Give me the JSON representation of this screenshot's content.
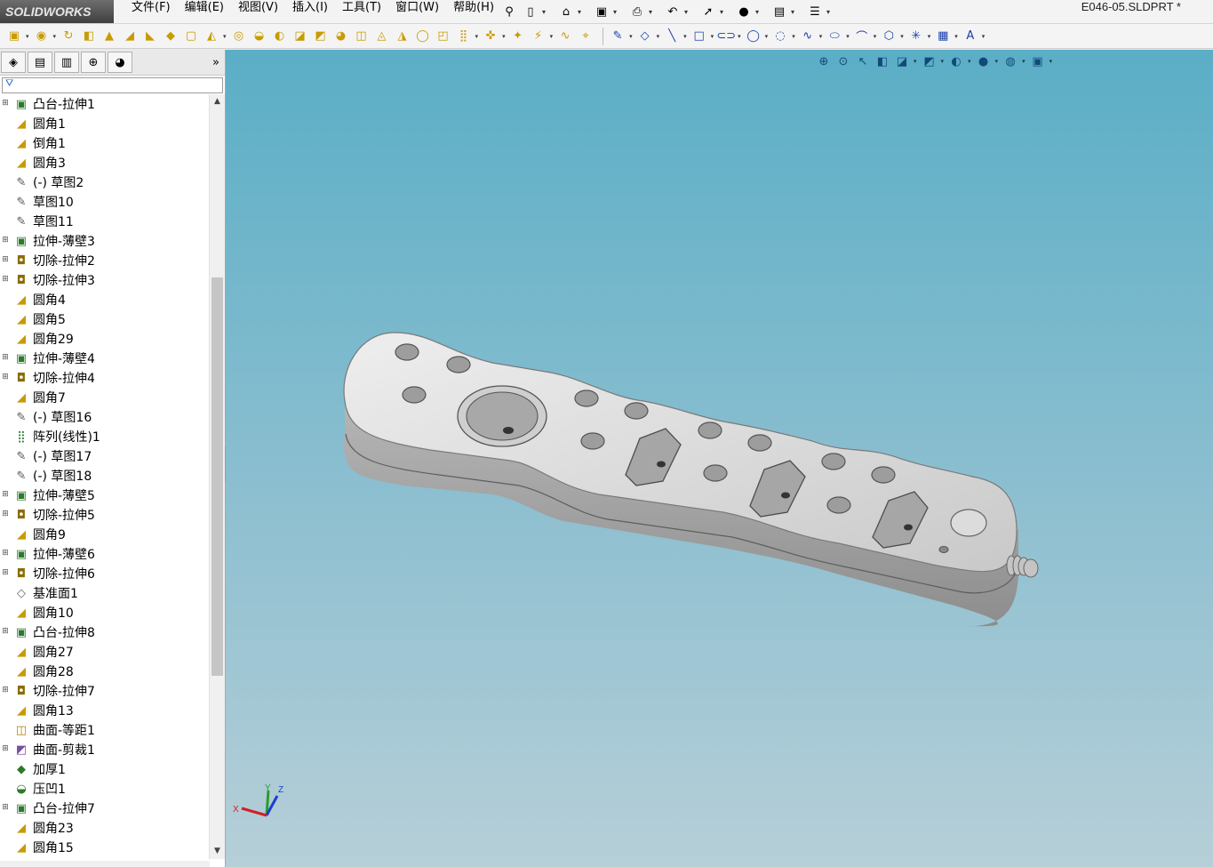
{
  "app": {
    "brand": "SOLIDWORKS",
    "document_title": "E046-05.SLDPRT *"
  },
  "menu": [
    "文件(F)",
    "编辑(E)",
    "视图(V)",
    "插入(I)",
    "工具(T)",
    "窗口(W)",
    "帮助(H)"
  ],
  "quick_access": [
    {
      "name": "pin-icon",
      "glyph": "⚲"
    },
    {
      "name": "new-document-icon",
      "glyph": "▯"
    },
    {
      "name": "open-folder-icon",
      "glyph": "⌂"
    },
    {
      "name": "save-icon",
      "glyph": "▣"
    },
    {
      "name": "print-icon",
      "glyph": "⎙"
    },
    {
      "name": "undo-icon",
      "glyph": "↶"
    },
    {
      "name": "select-arrow-icon",
      "glyph": "➚"
    },
    {
      "name": "rebuild-icon",
      "glyph": "●"
    },
    {
      "name": "file-properties-icon",
      "glyph": "▤"
    },
    {
      "name": "options-icon",
      "glyph": "☰"
    }
  ],
  "feature_toolbar": [
    {
      "name": "extrude-boss-icon",
      "glyph": "▣"
    },
    {
      "name": "revolve-icon",
      "glyph": "◉"
    },
    {
      "name": "sweep-icon",
      "glyph": "↻"
    },
    {
      "name": "loft-icon",
      "glyph": "◧"
    },
    {
      "name": "boundary-icon",
      "glyph": "▲"
    },
    {
      "name": "fillet-icon",
      "glyph": "◢"
    },
    {
      "name": "chamfer-icon",
      "glyph": "◣"
    },
    {
      "name": "rib-icon",
      "glyph": "◆"
    },
    {
      "name": "shell-icon",
      "glyph": "▢"
    },
    {
      "name": "draft-icon",
      "glyph": "◭"
    },
    {
      "name": "hole-icon",
      "glyph": "◎"
    },
    {
      "name": "dome-icon",
      "glyph": "◒"
    },
    {
      "name": "wrap-icon",
      "glyph": "◐"
    },
    {
      "name": "intersect-icon",
      "glyph": "◪"
    },
    {
      "name": "mirror-icon",
      "glyph": "◩"
    },
    {
      "name": "curve-icon",
      "glyph": "◕"
    },
    {
      "name": "split-icon",
      "glyph": "◫"
    },
    {
      "name": "combine-icon",
      "glyph": "◬"
    },
    {
      "name": "indent-icon",
      "glyph": "◮"
    },
    {
      "name": "move-face-icon",
      "glyph": "◯"
    },
    {
      "name": "delete-face-icon",
      "glyph": "◰"
    },
    {
      "name": "linear-pattern-icon",
      "glyph": "⣿"
    },
    {
      "name": "reference-geometry-icon",
      "glyph": "✜"
    },
    {
      "name": "curves-icon",
      "glyph": "✦"
    },
    {
      "name": "instant3d-icon",
      "glyph": "⚡"
    },
    {
      "name": "spline-icon",
      "glyph": "∿"
    },
    {
      "name": "smart-dimension-icon",
      "glyph": "⌖"
    }
  ],
  "sketch_toolbar": [
    {
      "name": "sketch-icon",
      "glyph": "✎"
    },
    {
      "name": "smart-dim-icon",
      "glyph": "◇"
    },
    {
      "name": "line-icon",
      "glyph": "╲"
    },
    {
      "name": "rectangle-icon",
      "glyph": "□"
    },
    {
      "name": "slot-icon",
      "glyph": "⊂⊃"
    },
    {
      "name": "circle-icon",
      "glyph": "◯"
    },
    {
      "name": "arc-icon",
      "glyph": "◌"
    },
    {
      "name": "spline-sketch-icon",
      "glyph": "∿"
    },
    {
      "name": "ellipse-icon",
      "glyph": "⬭"
    },
    {
      "name": "fillet-sketch-icon",
      "glyph": "⌒"
    },
    {
      "name": "polygon-icon",
      "glyph": "⬡"
    },
    {
      "name": "point-icon",
      "glyph": "✳"
    },
    {
      "name": "sketch-grid-icon",
      "glyph": "▦"
    },
    {
      "name": "text-icon",
      "glyph": "A"
    }
  ],
  "panel_tabs": [
    {
      "name": "feature-manager-tab",
      "glyph": "◈"
    },
    {
      "name": "property-manager-tab",
      "glyph": "▤"
    },
    {
      "name": "configuration-manager-tab",
      "glyph": "▥"
    },
    {
      "name": "dimxpert-tab",
      "glyph": "⊕"
    },
    {
      "name": "display-manager-tab",
      "glyph": "◕"
    }
  ],
  "panel_expand": "»",
  "filter_glyph": "⛛",
  "feature_tree": [
    {
      "label": "凸台-拉伸1",
      "type": "extrude",
      "expandable": true
    },
    {
      "label": "圆角1",
      "type": "fillet",
      "expandable": false
    },
    {
      "label": "倒角1",
      "type": "fillet",
      "expandable": false
    },
    {
      "label": "圆角3",
      "type": "fillet",
      "expandable": false
    },
    {
      "label": "(-) 草图2",
      "type": "sketch",
      "expandable": false
    },
    {
      "label": "草图10",
      "type": "sketch",
      "expandable": false
    },
    {
      "label": "草图11",
      "type": "sketch",
      "expandable": false
    },
    {
      "label": "拉伸-薄壁3",
      "type": "extrude",
      "expandable": true
    },
    {
      "label": "切除-拉伸2",
      "type": "cut",
      "expandable": true
    },
    {
      "label": "切除-拉伸3",
      "type": "cut",
      "expandable": true
    },
    {
      "label": "圆角4",
      "type": "fillet",
      "expandable": false
    },
    {
      "label": "圆角5",
      "type": "fillet",
      "expandable": false
    },
    {
      "label": "圆角29",
      "type": "fillet",
      "expandable": false
    },
    {
      "label": "拉伸-薄壁4",
      "type": "extrude",
      "expandable": true
    },
    {
      "label": "切除-拉伸4",
      "type": "cut",
      "expandable": true
    },
    {
      "label": "圆角7",
      "type": "fillet",
      "expandable": false
    },
    {
      "label": "(-) 草图16",
      "type": "sketch",
      "expandable": false
    },
    {
      "label": "阵列(线性)1",
      "type": "pattern",
      "expandable": false
    },
    {
      "label": "(-) 草图17",
      "type": "sketch",
      "expandable": false
    },
    {
      "label": "(-) 草图18",
      "type": "sketch",
      "expandable": false
    },
    {
      "label": "拉伸-薄壁5",
      "type": "extrude",
      "expandable": true
    },
    {
      "label": "切除-拉伸5",
      "type": "cut",
      "expandable": true
    },
    {
      "label": "圆角9",
      "type": "fillet",
      "expandable": false
    },
    {
      "label": "拉伸-薄壁6",
      "type": "extrude",
      "expandable": true
    },
    {
      "label": "切除-拉伸6",
      "type": "cut",
      "expandable": true
    },
    {
      "label": "基准面1",
      "type": "plane",
      "expandable": false
    },
    {
      "label": "圆角10",
      "type": "fillet",
      "expandable": false
    },
    {
      "label": "凸台-拉伸8",
      "type": "extrude",
      "expandable": true
    },
    {
      "label": "圆角27",
      "type": "fillet",
      "expandable": false
    },
    {
      "label": "圆角28",
      "type": "fillet",
      "expandable": false
    },
    {
      "label": "切除-拉伸7",
      "type": "cut",
      "expandable": true
    },
    {
      "label": "圆角13",
      "type": "fillet",
      "expandable": false
    },
    {
      "label": "曲面-等距1",
      "type": "surface",
      "expandable": false
    },
    {
      "label": "曲面-剪裁1",
      "type": "surface-trim",
      "expandable": true
    },
    {
      "label": "加厚1",
      "type": "thicken",
      "expandable": false
    },
    {
      "label": "压凹1",
      "type": "indent",
      "expandable": false
    },
    {
      "label": "凸台-拉伸7",
      "type": "extrude",
      "expandable": true
    },
    {
      "label": "圆角23",
      "type": "fillet",
      "expandable": false
    },
    {
      "label": "圆角15",
      "type": "fillet",
      "expandable": false
    }
  ],
  "feature_icons": {
    "extrude": {
      "glyph": "▣",
      "color": "#2c7a2c"
    },
    "cut": {
      "glyph": "◘",
      "color": "#8a6d00"
    },
    "fillet": {
      "glyph": "◢",
      "color": "#c99a00"
    },
    "sketch": {
      "glyph": "✎",
      "color": "#555555"
    },
    "pattern": {
      "glyph": "⣿",
      "color": "#2c7a2c"
    },
    "plane": {
      "glyph": "◇",
      "color": "#666666"
    },
    "surface": {
      "glyph": "◫",
      "color": "#b08300"
    },
    "surface-trim": {
      "glyph": "◩",
      "color": "#7a4fa0"
    },
    "thicken": {
      "glyph": "◆",
      "color": "#2c7a2c"
    },
    "indent": {
      "glyph": "◒",
      "color": "#2c7a2c"
    }
  },
  "view_toolbar": [
    {
      "name": "zoom-to-fit-icon",
      "glyph": "⊕"
    },
    {
      "name": "zoom-area-icon",
      "glyph": "⊙"
    },
    {
      "name": "previous-view-icon",
      "glyph": "↖"
    },
    {
      "name": "section-view-icon",
      "glyph": "◧"
    },
    {
      "name": "view-orientation-icon",
      "glyph": "◪"
    },
    {
      "name": "display-style-icon",
      "glyph": "◩"
    },
    {
      "name": "hide-show-icon",
      "glyph": "◐"
    },
    {
      "name": "appearance-icon",
      "glyph": "●"
    },
    {
      "name": "scene-icon",
      "glyph": "◍"
    },
    {
      "name": "view-settings-icon",
      "glyph": "▣"
    }
  ],
  "triad": {
    "x": "X",
    "y": "Y",
    "z": "Z"
  },
  "colors": {
    "viewport_top": "#5aaec6",
    "viewport_bottom": "#b6cfd8",
    "part_top": "#d9d9d9",
    "part_side": "#a9a9a9"
  }
}
